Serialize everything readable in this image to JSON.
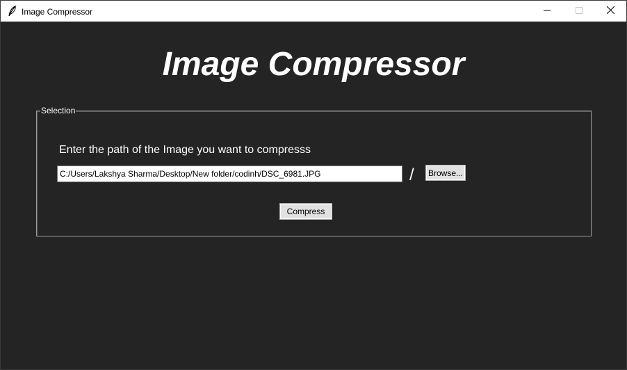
{
  "window": {
    "title": "Image Compressor",
    "controls": {
      "minimize_icon": "minimize-icon",
      "maximize_icon": "maximize-icon",
      "close_icon": "close-icon"
    },
    "app_icon": "feather-icon"
  },
  "main": {
    "heading": "Image Compressor",
    "selection": {
      "legend": "Selection",
      "prompt": "Enter the path of the Image you want to compresss",
      "path_value": "C:/Users/Lakshya Sharma/Desktop/New folder/codinh/DSC_6981.JPG",
      "separator": "/",
      "browse_label": "Browse...",
      "compress_label": "Compress"
    }
  },
  "colors": {
    "background": "#242424",
    "text": "#ffffff",
    "button_face": "#e1e1e1",
    "frame_border": "#a0a0a0"
  }
}
